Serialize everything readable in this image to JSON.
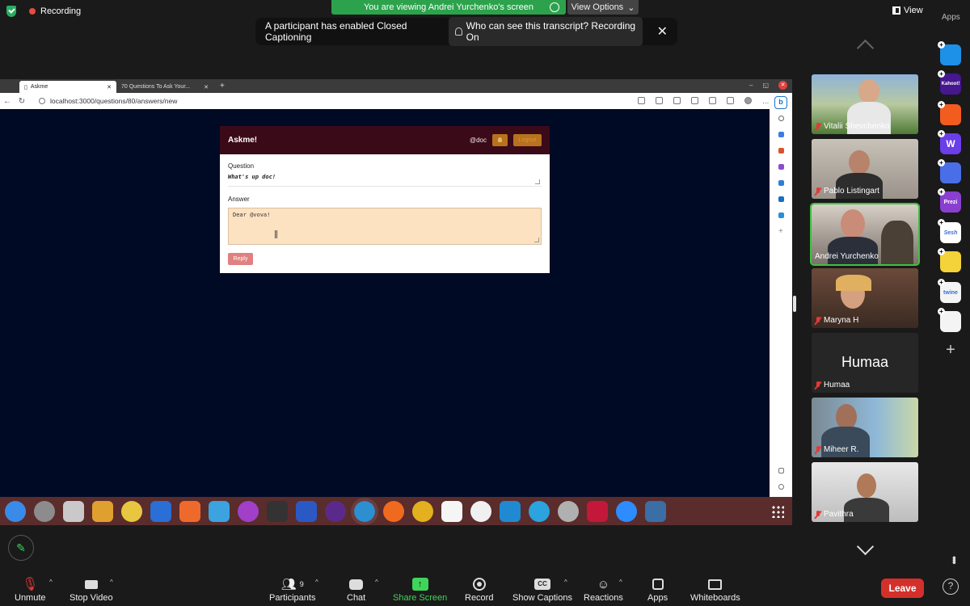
{
  "top": {
    "recording": "Recording",
    "viewing_banner": "You are viewing Andrei Yurchenko's screen",
    "view_options": "View Options",
    "view": "View",
    "apps": "Apps"
  },
  "caption_banner": {
    "message": "A participant has enabled Closed Captioning",
    "who_link": "Who can see this transcript? Recording On"
  },
  "browser": {
    "tabs": [
      {
        "label": "Askme"
      },
      {
        "label": "70 Questions To Ask Your..."
      }
    ],
    "url": "localhost:3000/questions/80/answers/new"
  },
  "askme": {
    "brand": "Askme!",
    "handle": "@doc",
    "logout": "Logout",
    "question_label": "Question",
    "question_text": "What's up doc!",
    "answer_label": "Answer",
    "answer_text": "Dear @vova!",
    "reply": "Reply"
  },
  "participants": [
    {
      "name": "Vitalii Shevchenko"
    },
    {
      "name": "Pablo Listingart"
    },
    {
      "name": "Andrei Yurchenko",
      "active_speaker": true
    },
    {
      "name": "Maryna H"
    },
    {
      "name": "Humaa",
      "avatar_text": "Humaa"
    },
    {
      "name": "Miheer R."
    },
    {
      "name": "Pavithra"
    }
  ],
  "side_apps": [
    {
      "name": "Kahoot!",
      "color": "#46178f"
    },
    {
      "name": "Prezi",
      "color": "#8a3fd1"
    },
    {
      "name": "Sesh",
      "color": "#ffffff"
    },
    {
      "name": "twine",
      "color": "#f4f4f4"
    }
  ],
  "toolbar": {
    "unmute": "Unmute",
    "stop_video": "Stop Video",
    "participants": "Participants",
    "participants_count": "9",
    "chat": "Chat",
    "share_screen": "Share Screen",
    "record": "Record",
    "show_captions": "Show Captions",
    "reactions": "Reactions",
    "apps": "Apps",
    "whiteboards": "Whiteboards",
    "leave": "Leave"
  },
  "colors": {
    "share_green": "#3fd45a",
    "leave_red": "#d4302b",
    "askme_header": "#3b0a19",
    "answer_bg": "#fde2c2"
  }
}
